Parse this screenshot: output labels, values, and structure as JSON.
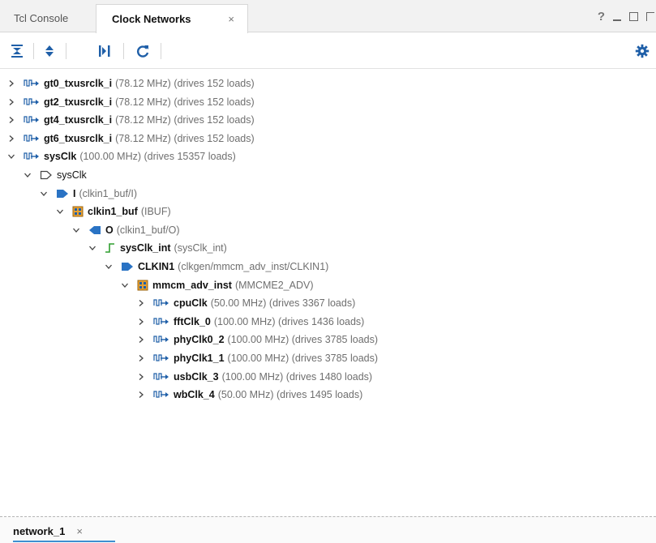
{
  "tabs": [
    {
      "label": "Tcl Console"
    },
    {
      "label": "Clock Networks",
      "close": "×"
    }
  ],
  "window_controls": {
    "help": "?"
  },
  "toolbar": {
    "buttons": [
      "collapse-all",
      "expand-all",
      "expand-one",
      "refresh"
    ],
    "settings": "settings"
  },
  "tree": [
    {
      "level": 0,
      "expanded": false,
      "icon": "clock-net-icon",
      "name": "gt0_txusrclk_i",
      "detail": "(78.12 MHz) (drives 152 loads)"
    },
    {
      "level": 0,
      "expanded": false,
      "icon": "clock-net-icon",
      "name": "gt2_txusrclk_i",
      "detail": "(78.12 MHz) (drives 152 loads)"
    },
    {
      "level": 0,
      "expanded": false,
      "icon": "clock-net-icon",
      "name": "gt4_txusrclk_i",
      "detail": "(78.12 MHz) (drives 152 loads)"
    },
    {
      "level": 0,
      "expanded": false,
      "icon": "clock-net-icon",
      "name": "gt6_txusrclk_i",
      "detail": "(78.12 MHz) (drives 152 loads)"
    },
    {
      "level": 0,
      "expanded": true,
      "icon": "clock-net-icon",
      "name": "sysClk",
      "detail": "(100.00 MHz) (drives 15357 loads)"
    },
    {
      "level": 1,
      "expanded": true,
      "icon": "port-icon",
      "name": "sysClk",
      "detail": ""
    },
    {
      "level": 2,
      "expanded": true,
      "icon": "input-pin-icon",
      "name": "I",
      "detail": "(clkin1_buf/I)"
    },
    {
      "level": 3,
      "expanded": true,
      "icon": "cell-icon",
      "name": "clkin1_buf",
      "detail": "(IBUF)"
    },
    {
      "level": 4,
      "expanded": true,
      "icon": "output-pin-icon",
      "name": "O",
      "detail": "(clkin1_buf/O)"
    },
    {
      "level": 5,
      "expanded": true,
      "icon": "net-icon",
      "name": "sysClk_int",
      "detail": "(sysClk_int)"
    },
    {
      "level": 6,
      "expanded": true,
      "icon": "input-pin-icon",
      "name": "CLKIN1",
      "detail": "(clkgen/mmcm_adv_inst/CLKIN1)"
    },
    {
      "level": 7,
      "expanded": true,
      "icon": "cell-icon",
      "name": "mmcm_adv_inst",
      "detail": "(MMCME2_ADV)"
    },
    {
      "level": 8,
      "expanded": false,
      "icon": "clock-net-icon",
      "name": "cpuClk",
      "detail": "(50.00 MHz) (drives 3367 loads)"
    },
    {
      "level": 8,
      "expanded": false,
      "icon": "clock-net-icon",
      "name": "fftClk_0",
      "detail": "(100.00 MHz) (drives 1436 loads)"
    },
    {
      "level": 8,
      "expanded": false,
      "icon": "clock-net-icon",
      "name": "phyClk0_2",
      "detail": "(100.00 MHz) (drives 3785 loads)"
    },
    {
      "level": 8,
      "expanded": false,
      "icon": "clock-net-icon",
      "name": "phyClk1_1",
      "detail": "(100.00 MHz) (drives 3785 loads)"
    },
    {
      "level": 8,
      "expanded": false,
      "icon": "clock-net-icon",
      "name": "usbClk_3",
      "detail": "(100.00 MHz) (drives 1480 loads)"
    },
    {
      "level": 8,
      "expanded": false,
      "icon": "clock-net-icon",
      "name": "wbClk_4",
      "detail": "(50.00 MHz) (drives 1495 loads)"
    }
  ],
  "bottom_tab": {
    "label": "network_1",
    "close": "×"
  },
  "colors": {
    "accent": "#3d8fd1",
    "icon_blue": "#1f5fa8",
    "cell_orange": "#e8a030",
    "net_green": "#2f9e2f"
  }
}
